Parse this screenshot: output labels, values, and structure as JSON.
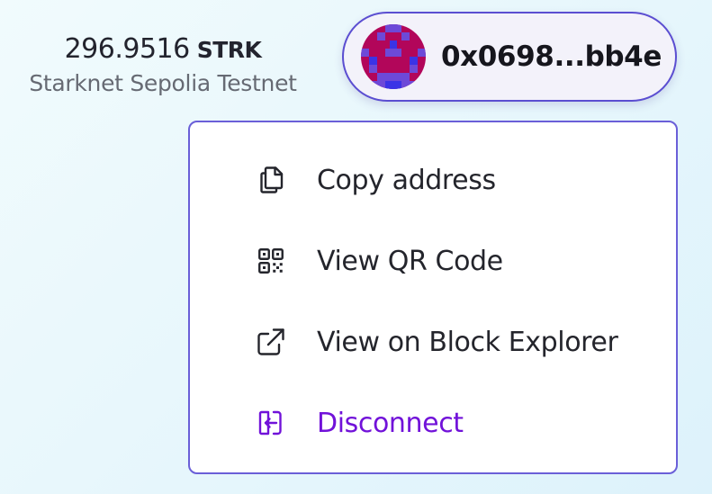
{
  "balance": {
    "amount": "296.9516",
    "symbol": "STRK",
    "network": "Starknet Sepolia Testnet"
  },
  "account": {
    "address": "0x0698...bb4e",
    "avatar_icon": "identicon-avatar"
  },
  "menu": {
    "items": [
      {
        "label": "Copy address",
        "icon": "copy-icon"
      },
      {
        "label": "View QR Code",
        "icon": "qr-code-icon"
      },
      {
        "label": "View on Block Explorer",
        "icon": "external-link-icon"
      },
      {
        "label": "Disconnect",
        "icon": "logout-icon"
      }
    ]
  },
  "colors": {
    "accent_border": "#5b4ed1",
    "disconnect": "#7112d9",
    "avatar_bg": "#b2065a",
    "avatar_fg": "#6d49d8",
    "avatar_accent": "#3b33e6"
  }
}
